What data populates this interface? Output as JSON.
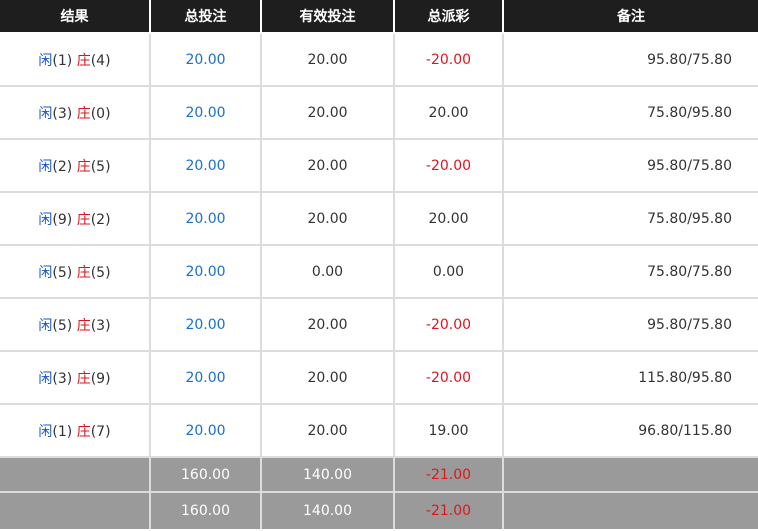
{
  "headers": [
    "结果",
    "总投注",
    "有效投注",
    "总派彩",
    "备注"
  ],
  "rows": [
    {
      "player_label": "闲",
      "player_score": "(1)",
      "banker_label": "庄",
      "banker_score": "(4)",
      "total_bet": "20.00",
      "valid_bet": "20.00",
      "payout": "-20.00",
      "payout_negative": true,
      "remark": "95.80/75.80"
    },
    {
      "player_label": "闲",
      "player_score": "(3)",
      "banker_label": "庄",
      "banker_score": "(0)",
      "total_bet": "20.00",
      "valid_bet": "20.00",
      "payout": "20.00",
      "payout_negative": false,
      "remark": "75.80/95.80"
    },
    {
      "player_label": "闲",
      "player_score": "(2)",
      "banker_label": "庄",
      "banker_score": "(5)",
      "total_bet": "20.00",
      "valid_bet": "20.00",
      "payout": "-20.00",
      "payout_negative": true,
      "remark": "95.80/75.80"
    },
    {
      "player_label": "闲",
      "player_score": "(9)",
      "banker_label": "庄",
      "banker_score": "(2)",
      "total_bet": "20.00",
      "valid_bet": "20.00",
      "payout": "20.00",
      "payout_negative": false,
      "remark": "75.80/95.80"
    },
    {
      "player_label": "闲",
      "player_score": "(5)",
      "banker_label": "庄",
      "banker_score": "(5)",
      "total_bet": "20.00",
      "valid_bet": "0.00",
      "payout": "0.00",
      "payout_negative": false,
      "remark": "75.80/75.80"
    },
    {
      "player_label": "闲",
      "player_score": "(5)",
      "banker_label": "庄",
      "banker_score": "(3)",
      "total_bet": "20.00",
      "valid_bet": "20.00",
      "payout": "-20.00",
      "payout_negative": true,
      "remark": "95.80/75.80"
    },
    {
      "player_label": "闲",
      "player_score": "(3)",
      "banker_label": "庄",
      "banker_score": "(9)",
      "total_bet": "20.00",
      "valid_bet": "20.00",
      "payout": "-20.00",
      "payout_negative": true,
      "remark": "115.80/95.80"
    },
    {
      "player_label": "闲",
      "player_score": "(1)",
      "banker_label": "庄",
      "banker_score": "(7)",
      "total_bet": "20.00",
      "valid_bet": "20.00",
      "payout": "19.00",
      "payout_negative": false,
      "remark": "96.80/115.80"
    }
  ],
  "summaries": [
    {
      "total_bet": "160.00",
      "valid_bet": "140.00",
      "payout": "-21.00"
    },
    {
      "total_bet": "160.00",
      "valid_bet": "140.00",
      "payout": "-21.00"
    }
  ],
  "colors": {
    "player": "#1a56c8",
    "banker": "#d9151b",
    "header_bg": "#1e1e1e",
    "summary_bg": "#9a9a9a",
    "negative": "#e0161d"
  }
}
